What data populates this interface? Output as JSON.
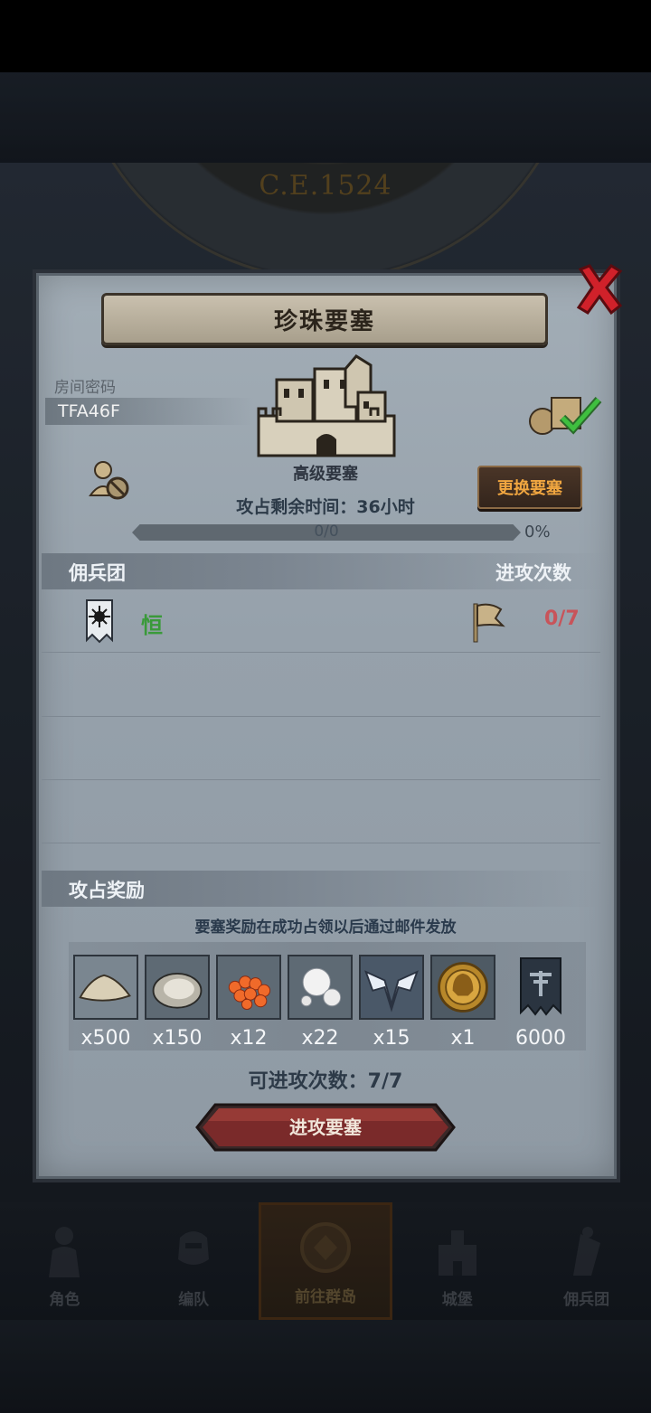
{
  "background": {
    "year": "C.E.1524"
  },
  "dialog": {
    "title": "珍珠要塞",
    "room_label": "房间密码",
    "room_code": "TFA46F",
    "fortress_type": "高级要塞",
    "change_button": "更换要塞",
    "timer": "攻占剩余时间：36小时",
    "progress": {
      "text": "0/0",
      "percent_label": "0%",
      "fraction": 0
    },
    "mercenary_header": "佣兵团",
    "attacks_header": "进攻次数",
    "team": {
      "name": "恒",
      "attacks": "0/7"
    },
    "reward_header": "攻占奖励",
    "reward_note": "要塞奖励在成功占领以后通过邮件发放",
    "rewards": [
      {
        "icon": "sand-pile-icon",
        "qty": "x500"
      },
      {
        "icon": "oyster-icon",
        "qty": "x150"
      },
      {
        "icon": "fish-roe-icon",
        "qty": "x12"
      },
      {
        "icon": "pearl-icon",
        "qty": "x22"
      },
      {
        "icon": "winged-crest-icon",
        "qty": "x15"
      },
      {
        "icon": "gold-helmet-coin-icon",
        "qty": "x1"
      },
      {
        "icon": "guild-banner-icon",
        "qty": "6000"
      }
    ],
    "attack_count": "可进攻次数：7/7",
    "attack_button": "进攻要塞"
  },
  "bottom_nav": [
    {
      "label": "角色",
      "icon": "character-icon"
    },
    {
      "label": "编队",
      "icon": "formation-icon"
    },
    {
      "label": "前往群岛",
      "icon": "island-compass-icon",
      "active": true
    },
    {
      "label": "城堡",
      "icon": "castle-icon"
    },
    {
      "label": "佣兵团",
      "icon": "mercenary-icon"
    }
  ],
  "colors": {
    "accent_orange": "#f0a640",
    "team_green": "#3a9a3a",
    "attack_red": "#c8545a",
    "close_red": "#d0212a"
  }
}
